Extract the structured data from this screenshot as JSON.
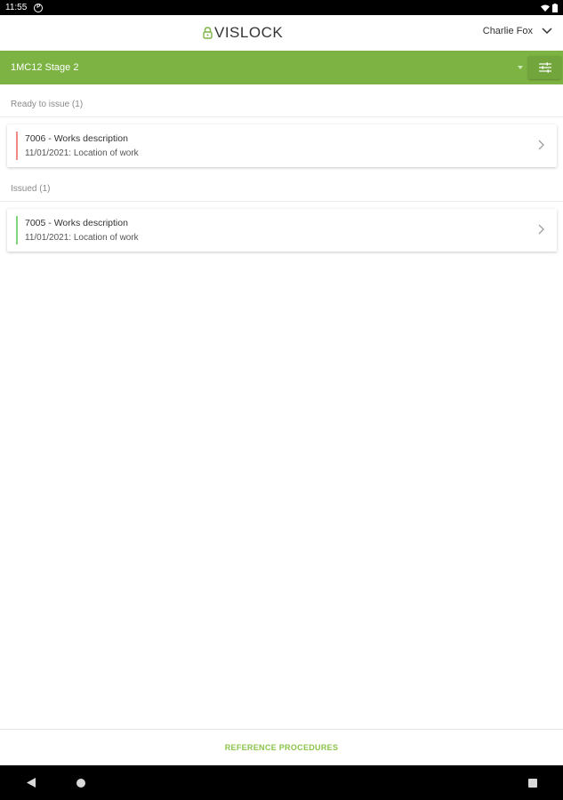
{
  "status_bar": {
    "time": "11:55",
    "notification_glyph": "P"
  },
  "header": {
    "logo_text": "VISLOCK",
    "user_name": "Charlie Fox"
  },
  "project_bar": {
    "project_name": "1MC12 Stage 2"
  },
  "sections": [
    {
      "header": "Ready to issue (1)",
      "items": [
        {
          "title": "7006 - Works description",
          "subtitle": "11/01/2021: Location of work",
          "status_color": "#ef8a8a"
        }
      ]
    },
    {
      "header": "Issued (1)",
      "items": [
        {
          "title": "7005 - Works description",
          "subtitle": "11/01/2021: Location of work",
          "status_color": "#7fd67f"
        }
      ]
    }
  ],
  "footer": {
    "reference_label": "REFERENCE PROCEDURES"
  },
  "colors": {
    "brand_green": "#7cb342",
    "link_green": "#8bc34a"
  }
}
